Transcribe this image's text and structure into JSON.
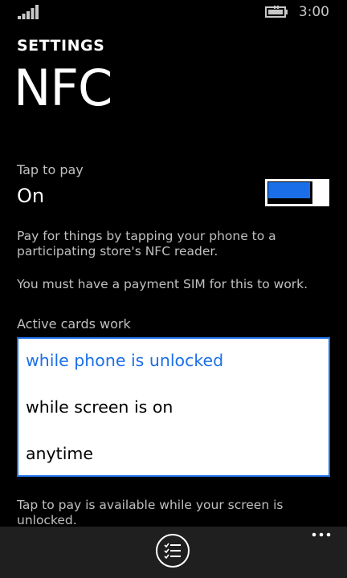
{
  "status_bar": {
    "signal_icon": "signal-strength-icon",
    "battery_icon": "battery-charging-icon",
    "time": "3:00"
  },
  "header": {
    "section": "SETTINGS",
    "title": "NFC"
  },
  "tap_to_pay": {
    "label": "Tap to pay",
    "state": "On",
    "enabled": true,
    "accent_color": "#1a6fe8"
  },
  "descriptions": {
    "pay_info": "Pay for things by tapping your phone to a participating store's NFC reader.",
    "sim_info": "You must have a payment SIM for this to work."
  },
  "active_cards": {
    "label": "Active cards work",
    "options": [
      "while phone is unlocked",
      "while screen is on",
      "anytime"
    ],
    "selected_index": 0
  },
  "footer_note": "Tap to pay is available while your screen is unlocked.",
  "app_bar": {
    "primary_icon": "manage-list-icon",
    "more_icon": "more-options-icon",
    "background": "#1f1f1f"
  }
}
